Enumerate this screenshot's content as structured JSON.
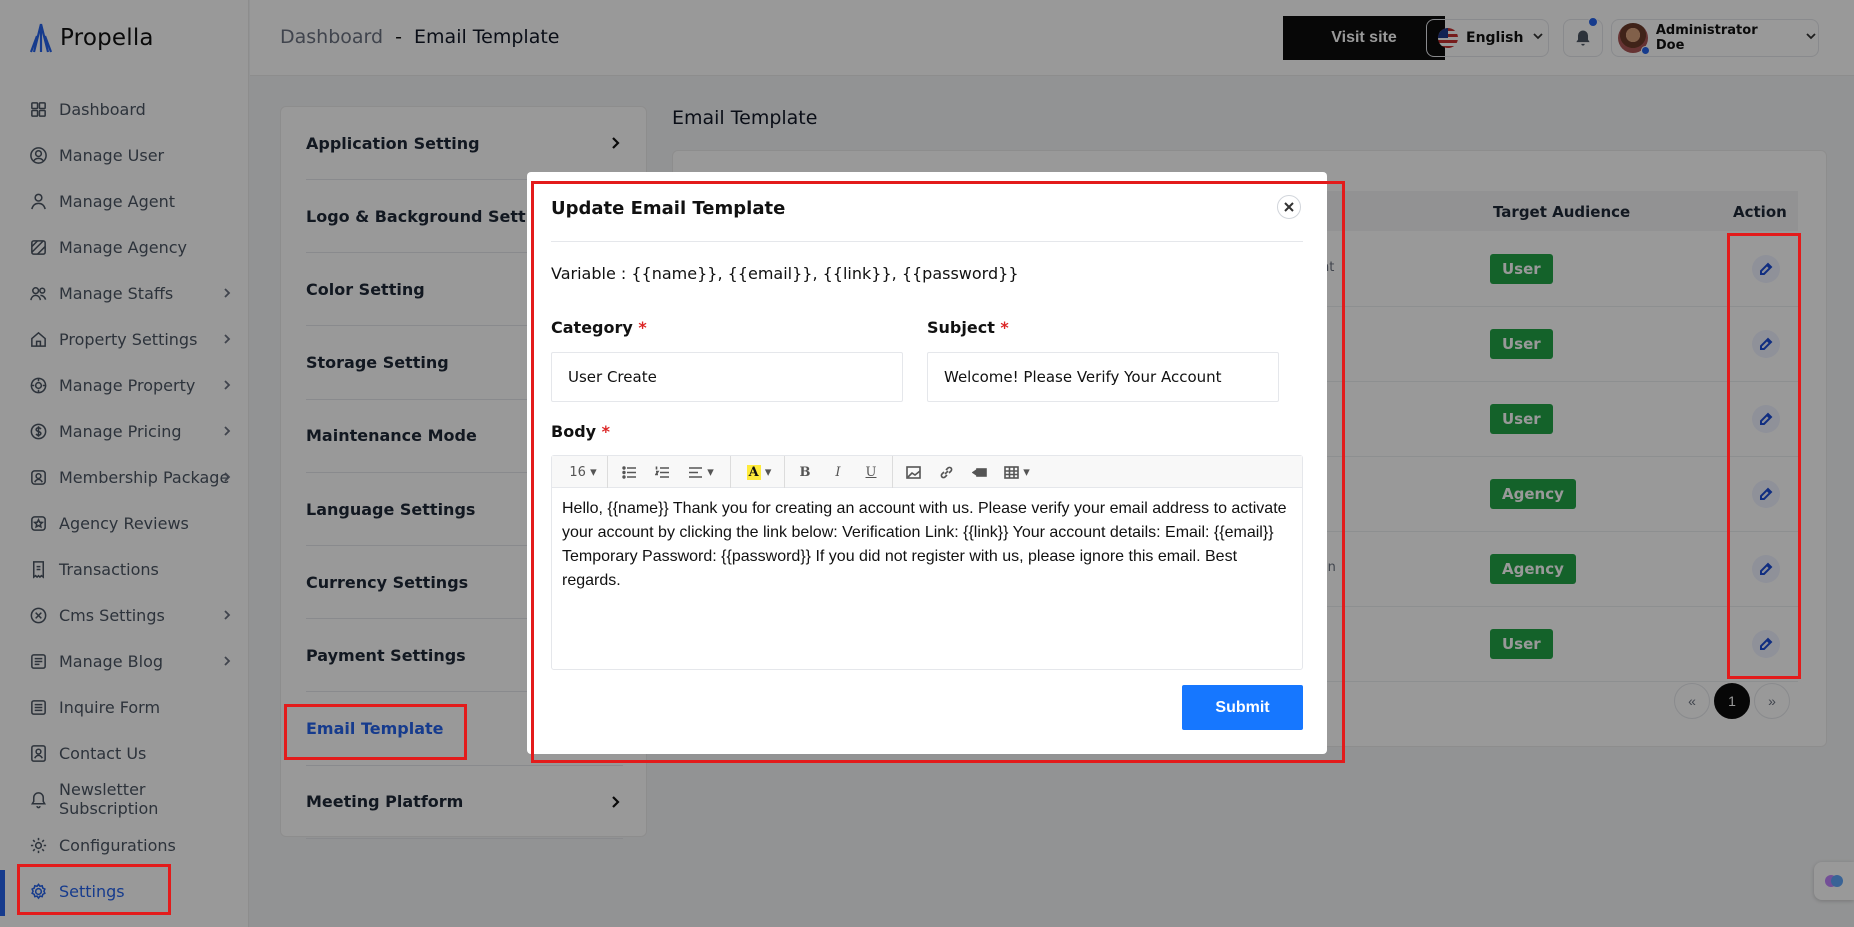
{
  "app": {
    "name": "Propella"
  },
  "sidebar": {
    "items": [
      {
        "label": "Dashboard",
        "icon": "grid-icon",
        "has_children": false
      },
      {
        "label": "Manage User",
        "icon": "user-circle-icon",
        "has_children": false
      },
      {
        "label": "Manage Agent",
        "icon": "agent-icon",
        "has_children": false
      },
      {
        "label": "Manage Agency",
        "icon": "agency-icon",
        "has_children": false
      },
      {
        "label": "Manage Staffs",
        "icon": "users-icon",
        "has_children": true
      },
      {
        "label": "Property Settings",
        "icon": "home-icon",
        "has_children": true
      },
      {
        "label": "Manage Property",
        "icon": "building-icon",
        "has_children": true
      },
      {
        "label": "Manage Pricing",
        "icon": "dollar-icon",
        "has_children": true
      },
      {
        "label": "Membership Package",
        "icon": "membership-icon",
        "has_children": true
      },
      {
        "label": "Agency Reviews",
        "icon": "star-icon",
        "has_children": false
      },
      {
        "label": "Transactions",
        "icon": "receipt-icon",
        "has_children": false
      },
      {
        "label": "Cms Settings",
        "icon": "cms-icon",
        "has_children": true
      },
      {
        "label": "Manage Blog",
        "icon": "blog-icon",
        "has_children": true
      },
      {
        "label": "Inquire Form",
        "icon": "form-icon",
        "has_children": false
      },
      {
        "label": "Contact Us",
        "icon": "contact-icon",
        "has_children": false
      },
      {
        "label": "Newsletter Subscription",
        "icon": "bell-icon",
        "has_children": false
      },
      {
        "label": "Configurations",
        "icon": "gear-icon",
        "has_children": false
      },
      {
        "label": "Settings",
        "icon": "settings-icon",
        "has_children": false,
        "active": true
      }
    ]
  },
  "header": {
    "breadcrumb_root": "Dashboard",
    "breadcrumb_sep": "-",
    "breadcrumb_current": "Email Template",
    "visit_site": "Visit site",
    "language": "English",
    "user_name": "Administrator Doe"
  },
  "settings_menu": {
    "items": [
      {
        "label": "Application Setting"
      },
      {
        "label": "Logo & Background Setting"
      },
      {
        "label": "Color Setting"
      },
      {
        "label": "Storage Setting"
      },
      {
        "label": "Maintenance Mode"
      },
      {
        "label": "Language Settings"
      },
      {
        "label": "Currency Settings"
      },
      {
        "label": "Payment Settings"
      },
      {
        "label": "Email Template",
        "active": true
      },
      {
        "label": "Meeting Platform"
      }
    ]
  },
  "main": {
    "title": "Email Template",
    "table": {
      "headers": {
        "target_audience": "Target Audience",
        "action": "Action"
      },
      "rows": [
        {
          "partial_text": "nt",
          "audience": "User"
        },
        {
          "partial_text": "",
          "audience": "User"
        },
        {
          "partial_text": "",
          "audience": "User"
        },
        {
          "partial_text": "",
          "audience": "Agency"
        },
        {
          "partial_text": "ation",
          "audience": "Agency"
        },
        {
          "partial_text": "",
          "audience": "User"
        }
      ]
    },
    "pagination": {
      "prev": "«",
      "current": "1",
      "next": "»"
    }
  },
  "modal": {
    "title": "Update Email Template",
    "variables": "Variable : {{name}}, {{email}}, {{link}}, {{password}}",
    "category_label": "Category",
    "category_value": "User Create",
    "subject_label": "Subject",
    "subject_value": "Welcome! Please Verify Your Account",
    "body_label": "Body",
    "required_mark": "*",
    "font_size": "16",
    "body_text": "Hello, {{name}} Thank you for creating an account with us. Please verify your email address to activate your account by clicking the link below: Verification Link: {{link}} Your account details: Email: {{email}} Temporary Password: {{password}} If you did not register with us, please ignore this email. Best regards.",
    "submit_label": "Submit"
  },
  "colors": {
    "accent": "#2563eb",
    "submit": "#1677ff",
    "badge": "#22a447",
    "annotation": "#e31b1b"
  }
}
